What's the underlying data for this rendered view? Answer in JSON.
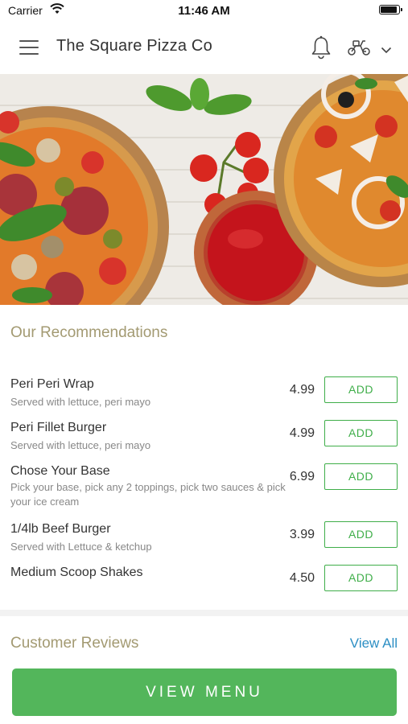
{
  "status_bar": {
    "carrier": "Carrier",
    "time": "11:46 AM"
  },
  "header": {
    "title": "The Square Pizza Co"
  },
  "recommendations": {
    "heading": "Our Recommendations",
    "items": [
      {
        "name": "Peri Peri Wrap",
        "description": "Served with lettuce, peri mayo",
        "price": "4.99",
        "button": "ADD"
      },
      {
        "name": "Peri Fillet Burger",
        "description": "Served with lettuce, peri mayo",
        "price": "4.99",
        "button": "ADD"
      },
      {
        "name": "Chose Your Base",
        "description": "Pick your base, pick any 2 toppings, pick two sauces & pick your ice cream",
        "price": "6.99",
        "button": "ADD"
      },
      {
        "name": "1/4lb Beef Burger",
        "description": "Served with Lettuce & ketchup",
        "price": "3.99",
        "button": "ADD"
      },
      {
        "name": "Medium Scoop Shakes",
        "description": "",
        "price": "4.50",
        "button": "ADD"
      }
    ]
  },
  "reviews": {
    "heading": "Customer Reviews",
    "view_all": "View All"
  },
  "footer": {
    "view_menu": "VIEW MENU"
  },
  "colors": {
    "accent_green": "#53b65b",
    "heading_gold": "#a39a72",
    "link_blue": "#2d8fc4"
  },
  "icons": [
    "wifi-icon",
    "battery-icon",
    "hamburger-menu-icon",
    "bell-icon",
    "scooter-icon",
    "chevron-down-icon"
  ]
}
